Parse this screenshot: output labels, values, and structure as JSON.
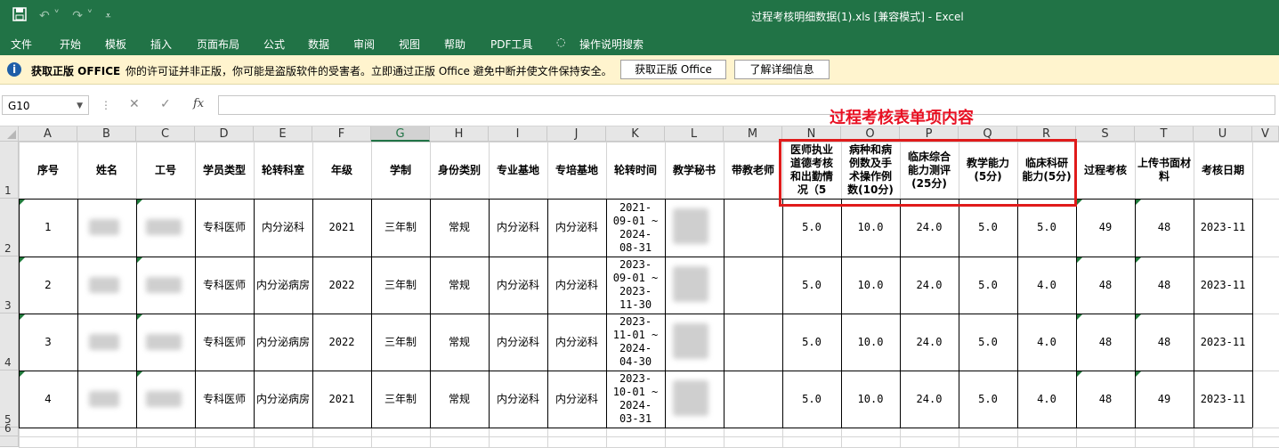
{
  "window": {
    "title": "过程考核明细数据(1).xls  [兼容模式]  -  Excel"
  },
  "ribbon_tabs": [
    "文件",
    "开始",
    "模板",
    "插入",
    "页面布局",
    "公式",
    "数据",
    "审阅",
    "视图",
    "帮助",
    "PDF工具",
    "操作说明搜索"
  ],
  "message_bar": {
    "title": "获取正版 OFFICE",
    "text": "你的许可证并非正版，你可能是盗版软件的受害者。立即通过正版 Office 避免中断并使文件保持安全。",
    "btn_get": "获取正版 Office",
    "btn_more": "了解详细信息"
  },
  "formula_bar": {
    "name_box": "G10",
    "fx": "fx"
  },
  "annotation": "过程考核表单项内容",
  "columns": [
    "A",
    "B",
    "C",
    "D",
    "E",
    "F",
    "G",
    "H",
    "I",
    "J",
    "K",
    "L",
    "M",
    "N",
    "O",
    "P",
    "Q",
    "R",
    "S",
    "T",
    "U",
    "V"
  ],
  "rows": [
    "1",
    "2",
    "3",
    "4",
    "5",
    "6"
  ],
  "header": [
    "序号",
    "姓名",
    "工号",
    "学员类型",
    "轮转科室",
    "年级",
    "学制",
    "身份类别",
    "专业基地",
    "专培基地",
    "轮转时间",
    "教学秘书",
    "带教老师",
    "医师执业道德考核和出勤情况（5",
    "病种和病例数及手术操作例数(10分)",
    "临床综合能力测评(25分)",
    "教学能力(5分)",
    "临床科研能力(5分)",
    "过程考核",
    "上传书面材料",
    "考核日期"
  ],
  "data_rows": [
    {
      "seq": "1",
      "type": "专科医师",
      "dept": "内分泌科",
      "grade": "2021",
      "system": "三年制",
      "identity": "常规",
      "base1": "内分泌科",
      "base2": "内分泌科",
      "time": "2021-09-01 ~ 2024-08-31",
      "n": "5.0",
      "o": "10.0",
      "p": "24.0",
      "q": "5.0",
      "r": "5.0",
      "s": "49",
      "t": "48",
      "u": "2023-11"
    },
    {
      "seq": "2",
      "type": "专科医师",
      "dept": "内分泌病房",
      "grade": "2022",
      "system": "三年制",
      "identity": "常规",
      "base1": "内分泌科",
      "base2": "内分泌科",
      "time": "2023-09-01 ~ 2023-11-30",
      "n": "5.0",
      "o": "10.0",
      "p": "24.0",
      "q": "5.0",
      "r": "4.0",
      "s": "48",
      "t": "48",
      "u": "2023-11"
    },
    {
      "seq": "3",
      "type": "专科医师",
      "dept": "内分泌病房",
      "grade": "2022",
      "system": "三年制",
      "identity": "常规",
      "base1": "内分泌科",
      "base2": "内分泌科",
      "time": "2023-11-01 ~ 2024-04-30",
      "n": "5.0",
      "o": "10.0",
      "p": "24.0",
      "q": "5.0",
      "r": "4.0",
      "s": "48",
      "t": "48",
      "u": "2023-11"
    },
    {
      "seq": "4",
      "type": "专科医师",
      "dept": "内分泌病房",
      "grade": "2021",
      "system": "三年制",
      "identity": "常规",
      "base1": "内分泌科",
      "base2": "内分泌科",
      "time": "2023-10-01 ~ 2024-03-31",
      "n": "5.0",
      "o": "10.0",
      "p": "24.0",
      "q": "5.0",
      "r": "4.0",
      "s": "48",
      "t": "49",
      "u": "2023-11"
    }
  ]
}
